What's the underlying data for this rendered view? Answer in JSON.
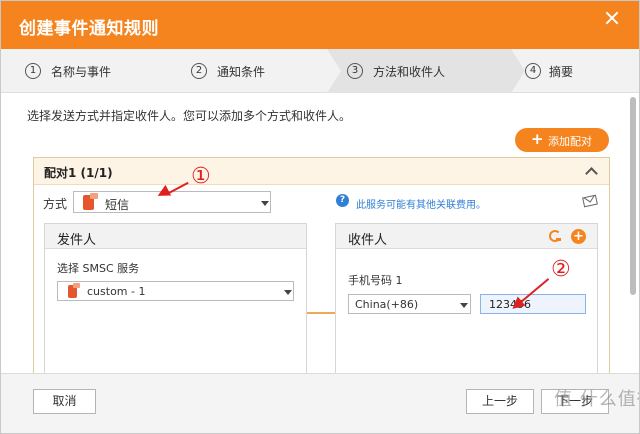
{
  "dialog": {
    "title": "创建事件通知规则"
  },
  "steps": [
    {
      "num": "1",
      "label": "名称与事件"
    },
    {
      "num": "2",
      "label": "通知条件"
    },
    {
      "num": "3",
      "label": "方法和收件人"
    },
    {
      "num": "4",
      "label": "摘要"
    }
  ],
  "instruction": "选择发送方式并指定收件人。您可以添加多个方式和收件人。",
  "add_pair_label": "添加配对",
  "pair": {
    "title": "配对1 (1/1)",
    "method_label": "方式",
    "method_value": "短信",
    "info_text": "此服务可能有其他关联费用。",
    "sender": {
      "title": "发件人",
      "smsc_label": "选择 SMSC 服务",
      "smsc_value": "custom - 1"
    },
    "receiver": {
      "title": "收件人",
      "phone_label": "手机号码 1",
      "country_value": "China(+86)",
      "phone_value": "123456"
    }
  },
  "annotations": {
    "one": "①",
    "two": "②",
    "color": "#e02020"
  },
  "footer": {
    "cancel": "取消",
    "prev": "上一步",
    "next": "下一步"
  },
  "watermark": "值 什么值得买",
  "colors": {
    "accent": "#f5841f",
    "info": "#2f7fd4"
  }
}
